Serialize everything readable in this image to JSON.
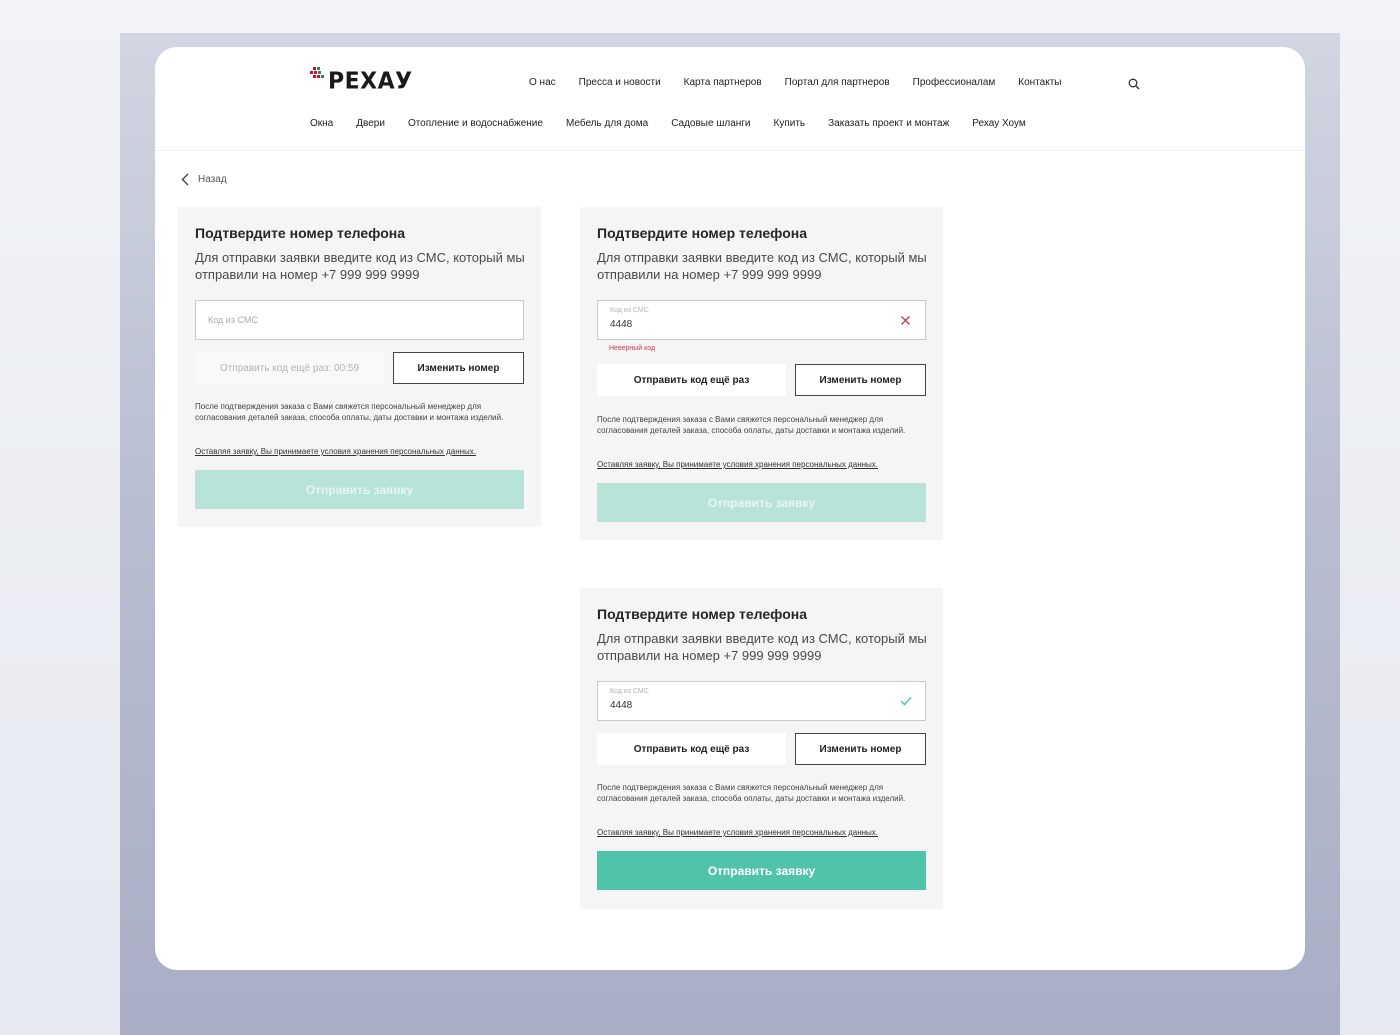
{
  "brand": {
    "logo_text": "РЕХАУ"
  },
  "nav": {
    "top": [
      "О нас",
      "Пресса и новости",
      "Карта партнеров",
      "Портал для партнеров",
      "Профессионалам",
      "Контакты"
    ],
    "bottom": [
      "Окна",
      "Двери",
      "Отопление и водоснабжение",
      "Мебель для дома",
      "Садовые шланги",
      "Купить",
      "Заказать проект и монтаж",
      "Рехау Хоум"
    ]
  },
  "back_label": "Назад",
  "forms": [
    {
      "title": "Подтвердите номер телефона",
      "description": "Для отправки заявки введите код из СМС, который мы отправили на номер +7 999 999 9999",
      "placeholder": "Код из СМС",
      "resend_label": "Отправить код ещё раз: 00:59",
      "change_label": "Изменить номер",
      "note": "После подтверждения заказа с Вами свяжется персональный менеджер для согласования деталей заказа, способа оплаты, даты доставки и монтажа изделий.",
      "consent": "Оставляя заявку, Вы принимаете условия хранения персональных данных.",
      "submit_label": "Отправить заявку"
    },
    {
      "title": "Подтвердите номер телефона",
      "description": "Для отправки заявки введите код из СМС, который мы отправили на номер +7 999 999 9999",
      "field_label": "Код из СМС",
      "value": "4448",
      "error": "Неверный код",
      "resend_label": "Отправить код ещё раз",
      "change_label": "Изменить номер",
      "note": "После подтверждения заказа с Вами свяжется персональный менеджер для согласования деталей заказа, способа оплаты, даты доставки и монтажа изделий.",
      "consent": "Оставляя заявку, Вы принимаете условия хранения персональных данных.",
      "submit_label": "Отправить заявку"
    },
    {
      "title": "Подтвердите номер телефона",
      "description": "Для отправки заявки введите код из СМС, который мы отправили на номер +7 999 999 9999",
      "field_label": "Код из СМС",
      "value": "4448",
      "resend_label": "Отправить код ещё раз",
      "change_label": "Изменить номер",
      "note": "После подтверждения заказа с Вами свяжется персональный менеджер для согласования деталей заказа, способа оплаты, даты доставки и монтажа изделий.",
      "consent": "Оставляя заявку, Вы принимаете условия хранения персональных данных.",
      "submit_label": "Отправить заявку"
    }
  ],
  "icons": {
    "search": "search-icon",
    "back": "chevron-left-icon",
    "clear": "close-icon",
    "valid": "check-icon"
  },
  "colors": {
    "accent": "#4fc4aa",
    "accent_disabled": "#b7e3d8",
    "error": "#d2394f",
    "logo_red": "#c8102e"
  }
}
